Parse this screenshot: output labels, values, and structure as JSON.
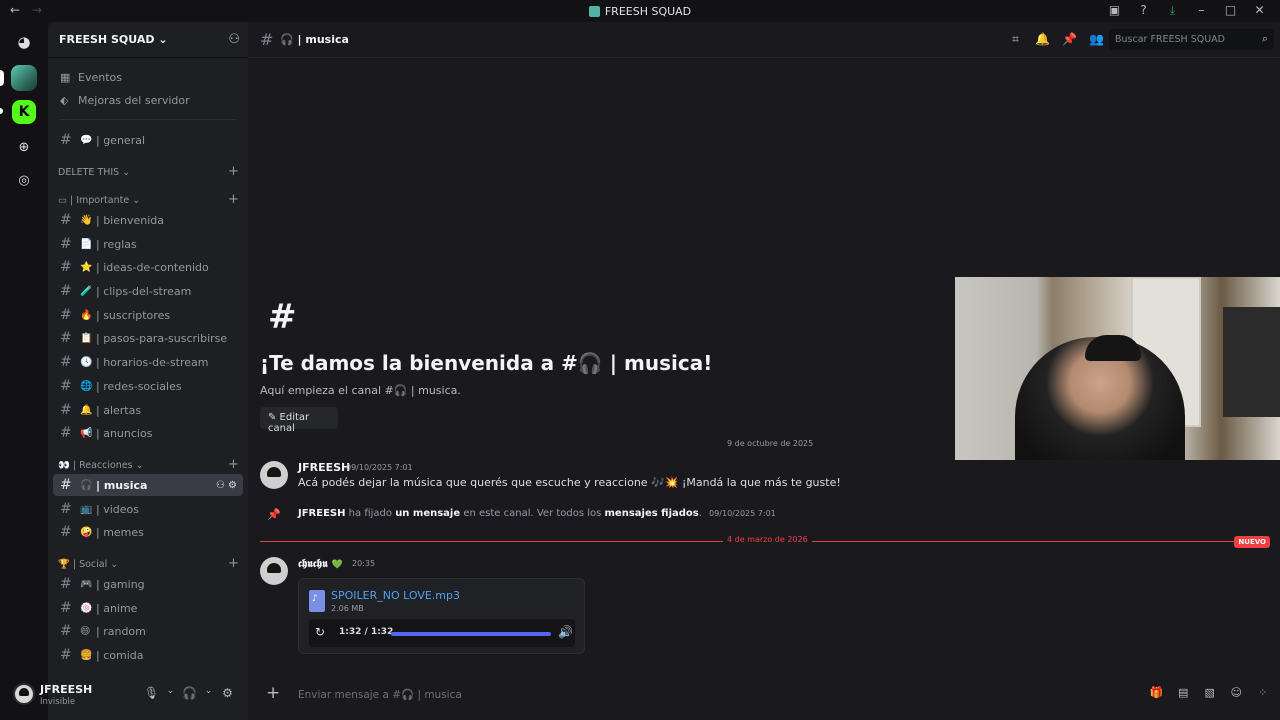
{
  "titlebar": {
    "title": "FREESH SQUAD",
    "back": "←",
    "forward": "→"
  },
  "server": {
    "name": "FREESH SQUAD"
  },
  "sidebar_top": [
    {
      "icon": "▦",
      "label": "Eventos"
    },
    {
      "icon": "⬖",
      "label": "Mejoras del servidor"
    }
  ],
  "channels_general": {
    "hash": "#",
    "emoji": "💬",
    "label": "| general"
  },
  "categories": {
    "delete_this": "DELETE THIS",
    "importante": "▭ | Importante",
    "reacciones": "👀 | Reacciones",
    "social": "🏆 | Social"
  },
  "channels_importante": [
    {
      "emoji": "👋",
      "label": "| bienvenida"
    },
    {
      "emoji": "📄",
      "label": "| reglas"
    },
    {
      "emoji": "⭐",
      "label": "| ideas-de-contenido"
    },
    {
      "emoji": "🧪",
      "label": "| clips-del-stream"
    },
    {
      "emoji": "🔥",
      "label": "| suscriptores"
    },
    {
      "emoji": "📋",
      "label": "| pasos-para-suscribirse"
    },
    {
      "emoji": "🕓",
      "label": "| horarios-de-stream"
    },
    {
      "emoji": "🌐",
      "label": "| redes-sociales"
    },
    {
      "emoji": "🔔",
      "label": "| alertas"
    },
    {
      "emoji": "📢",
      "label": "| anuncios"
    }
  ],
  "channels_reacciones": [
    {
      "emoji": "🎧",
      "label": "| musica"
    },
    {
      "emoji": "📺",
      "label": "| videos"
    },
    {
      "emoji": "🤪",
      "label": "| memes"
    }
  ],
  "channels_social": [
    {
      "emoji": "🎮",
      "label": "| gaming"
    },
    {
      "emoji": "🍥",
      "label": "| anime"
    },
    {
      "emoji": "😄",
      "label": "| random"
    },
    {
      "emoji": "🍔",
      "label": "| comida"
    }
  ],
  "user": {
    "name": "JFREESH",
    "status": "Invisible"
  },
  "channel": {
    "name": "🎧 | musica"
  },
  "search": {
    "placeholder": "Buscar FREESH SQUAD"
  },
  "welcome": {
    "hash": "#",
    "title": "¡Te damos la bienvenida a #🎧 | musica!",
    "subtitle": "Aquí empieza el canal #🎧 | musica.",
    "edit_label": "✎ Editar canal"
  },
  "date1": "9 de octubre de 2025",
  "msg1": {
    "author": "JFREESH",
    "time": "09/10/2025 7:01",
    "text": "Acá podés dejar la música que querés que escuche y reaccione 🎶💥 ¡Mandá la que más te guste!"
  },
  "system": {
    "author": "JFREESH",
    "t1": " ha fijado ",
    "link1": "un mensaje",
    "t2": " en este canal. Ver todos los ",
    "link2": "mensajes fijados",
    "t3": ".",
    "time": "09/10/2025 7:01"
  },
  "date2": "4 de marzo de 2026",
  "new_badge": "NUEVO",
  "msg2": {
    "author": "𝖈𝖍𝖚𝖈𝖍𝖚",
    "badge": "💚",
    "time": "20:35",
    "file": {
      "name": "SPOILER_NO LOVE.mp3",
      "size": "2.06 MB",
      "time": "1:32 / 1:32",
      "progress": 1.0
    }
  },
  "composer": {
    "placeholder": "Enviar mensaje a #🎧 | musica"
  },
  "colors": {
    "accent": "#5865f2",
    "new": "#f23f42",
    "link": "#4fa3f7"
  }
}
